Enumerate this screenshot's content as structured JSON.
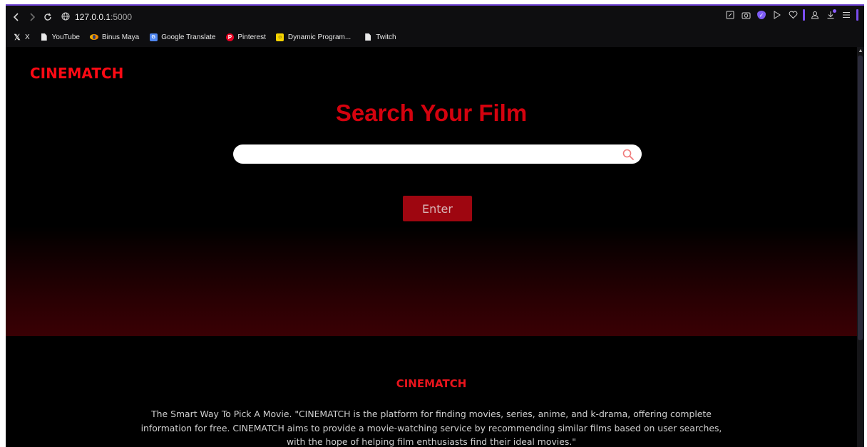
{
  "browser": {
    "url_host": "127.0.0.1",
    "url_port": ":5000",
    "bookmarks": [
      {
        "label": "X",
        "icon": "x-logo-icon"
      },
      {
        "label": "YouTube",
        "icon": "document-icon"
      },
      {
        "label": "Binus Maya",
        "icon": "binus-maya-icon"
      },
      {
        "label": "Google Translate",
        "icon": "google-translate-icon"
      },
      {
        "label": "Pinterest",
        "icon": "pinterest-icon"
      },
      {
        "label": "Dynamic Program...",
        "icon": "dynamic-programming-icon"
      },
      {
        "label": "Twitch",
        "icon": "document-icon"
      }
    ],
    "accent_color": "#7b4df0"
  },
  "page": {
    "logo": "CINEMATCH",
    "title": "Search Your Film",
    "search": {
      "value": "",
      "placeholder": ""
    },
    "enter_label": "Enter",
    "footer": {
      "logo": "CINEMATCH",
      "description_line1": "The Smart Way To Pick A Movie. \"CINEMATCH is the platform for finding movies, series, anime, and k-drama, offering complete",
      "description_line2": "information for free. CINEMATCH aims to provide a movie-watching service by recommending similar films based on user searches,",
      "description_line3": "with the hope of helping film enthusiasts find their ideal movies.\""
    },
    "colors": {
      "brand_red": "#ff0a14",
      "title_red": "#d4020e",
      "button_red": "#9e0610"
    }
  }
}
